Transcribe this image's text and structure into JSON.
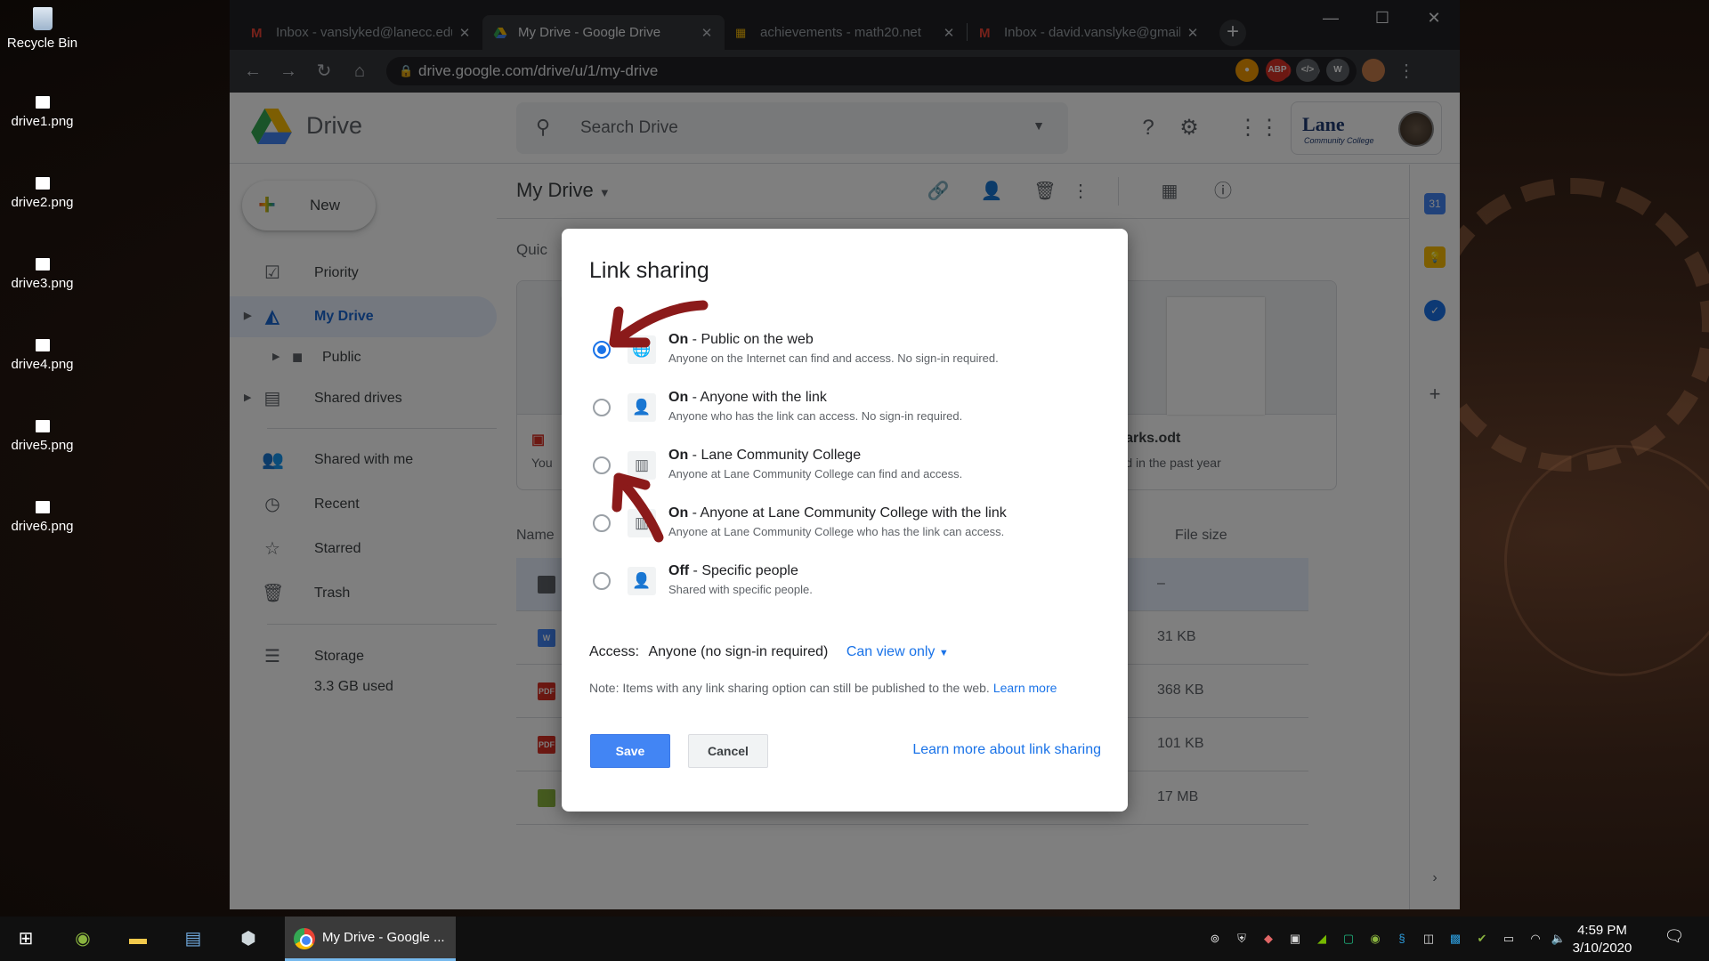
{
  "desktop": {
    "icons": [
      {
        "label": "Recycle Bin"
      },
      {
        "label": "drive1.png"
      },
      {
        "label": "drive2.png"
      },
      {
        "label": "drive3.png"
      },
      {
        "label": "drive4.png"
      },
      {
        "label": "drive5.png"
      },
      {
        "label": "drive6.png"
      }
    ]
  },
  "browser": {
    "tabs": [
      {
        "title": "Inbox - vanslyked@lanecc.edu",
        "icon": "gmail-icon"
      },
      {
        "title": "My Drive - Google Drive",
        "icon": "drive-icon",
        "active": true
      },
      {
        "title": "achievements - math20.net",
        "icon": "site-icon"
      },
      {
        "title": "Inbox - david.vanslyke@gmail.com",
        "icon": "gmail-icon"
      }
    ],
    "url": "drive.google.com/drive/u/1/my-drive"
  },
  "drive": {
    "app_name": "Drive",
    "search_placeholder": "Search Drive",
    "account_org": "Lane",
    "account_org_sub": "Community College",
    "new_label": "New",
    "nav": [
      {
        "label": "Priority"
      },
      {
        "label": "My Drive"
      },
      {
        "label": "Public"
      },
      {
        "label": "Shared drives"
      },
      {
        "label": "Shared with me"
      },
      {
        "label": "Recent"
      },
      {
        "label": "Starred"
      },
      {
        "label": "Trash"
      },
      {
        "label": "Storage"
      }
    ],
    "storage_used": "3.3 GB used",
    "breadcrumb": "My Drive",
    "quick_access": "Quic",
    "cards": [
      {
        "title": "",
        "sub": "You"
      },
      {
        "title": "kmarks.odt",
        "sub": "aded in the past year"
      }
    ],
    "list_headers": {
      "name": "Name",
      "size": "File size"
    },
    "rows": [
      {
        "size": "–"
      },
      {
        "size": "31 KB"
      },
      {
        "size": "368 KB"
      },
      {
        "size": "101 KB"
      },
      {
        "size": "17 MB"
      }
    ]
  },
  "dialog": {
    "title": "Link sharing",
    "options": [
      {
        "state": "On",
        "label": " - Public on the web",
        "desc": "Anyone on the Internet can find and access. No sign-in required.",
        "selected": true
      },
      {
        "state": "On",
        "label": " - Anyone with the link",
        "desc": "Anyone who has the link can access. No sign-in required."
      },
      {
        "state": "On",
        "label": " - Lane Community College",
        "desc": "Anyone at Lane Community College can find and access."
      },
      {
        "state": "On",
        "label": " - Anyone at Lane Community College with the link",
        "desc": "Anyone at Lane Community College who has the link can access."
      },
      {
        "state": "Off",
        "label": " - Specific people",
        "desc": "Shared with specific people."
      }
    ],
    "access_label": "Access:",
    "access_who": "Anyone (no sign-in required)",
    "access_perm": "Can view only",
    "note": "Note: Items with any link sharing option can still be published to the web.",
    "note_link": "Learn more",
    "save": "Save",
    "cancel": "Cancel",
    "learn_more": "Learn more about link sharing"
  },
  "taskbar": {
    "app_title": "My Drive - Google ...",
    "time": "4:59 PM",
    "date": "3/10/2020"
  },
  "colors": {
    "accent": "#1a73e8",
    "annotation": "#8b1a1a"
  }
}
